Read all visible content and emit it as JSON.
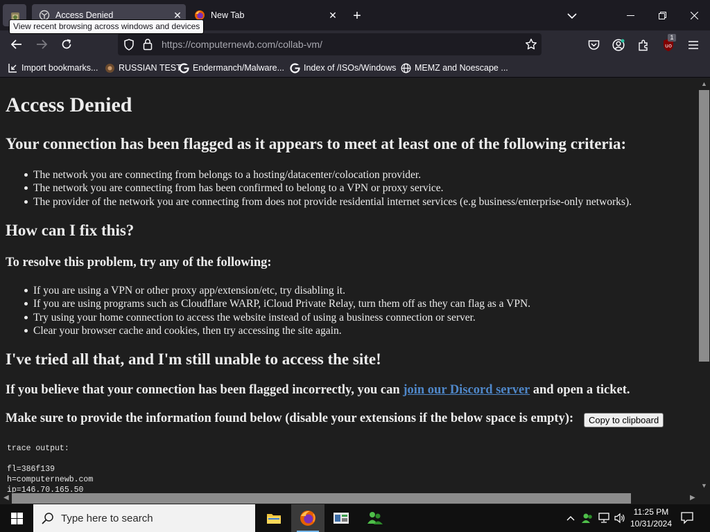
{
  "browser": {
    "tabs": [
      {
        "title": "Access Denied",
        "active": true
      },
      {
        "title": "New Tab",
        "active": false
      }
    ],
    "tooltip": "View recent browsing across windows and devices",
    "url": {
      "host": "https://computernewb.com",
      "path": "/collab-vm/"
    },
    "extension_badge": "1",
    "bookmarks": [
      {
        "label": "Import bookmarks...",
        "icon": "import-icon"
      },
      {
        "label": "RUSSIAN TEST",
        "icon": "russian-test-icon"
      },
      {
        "label": "Endermanch/Malware...",
        "icon": "google-icon"
      },
      {
        "label": "Index of /ISOs/Windows",
        "icon": "google-icon"
      },
      {
        "label": "MEMZ and Noescape ...",
        "icon": "globe-icon"
      }
    ]
  },
  "page": {
    "title": "Access Denied",
    "flag_heading": "Your connection has been flagged as it appears to meet at least one of the following criteria:",
    "criteria": [
      "The network you are connecting from belongs to a hosting/datacenter/colocation provider.",
      "The network you are connecting from has been confirmed to belong to a VPN or proxy service.",
      "The provider of the network you are connecting from does not provide residential internet services (e.g business/enterprise-only networks)."
    ],
    "fix_heading": "How can I fix this?",
    "resolve_heading": "To resolve this problem, try any of the following:",
    "fixes": [
      "If you are using a VPN or other proxy app/extension/etc, try disabling it.",
      "If you are using programs such as Cloudflare WARP, iCloud Private Relay, turn them off as they can flag as a VPN.",
      "Try using your home connection to access the website instead of using a business connection or server.",
      "Clear your browser cache and cookies, then try accessing the site again."
    ],
    "still_heading": "I've tried all that, and I'm still unable to access the site!",
    "ticket_prefix": "If you believe that your connection has been flagged incorrectly, you can ",
    "discord_link": "join our Discord server",
    "ticket_suffix": " and open a ticket.",
    "provide_text": "Make sure to provide the information found below (disable your extensions if the below space is empty):",
    "copy_button": "Copy to clipboard",
    "trace_header": "trace output:",
    "trace_lines": [
      "fl=386f139",
      "h=computernewb.com",
      "ip=146.70.165.50"
    ]
  },
  "taskbar": {
    "search_placeholder": "Type here to search",
    "time": "11:25 PM",
    "date": "10/31/2024",
    "apps": [
      "file-explorer",
      "firefox",
      "network-app",
      "people-app"
    ]
  },
  "colors": {
    "page_bg": "#1e1e1e",
    "link": "#4f87c9",
    "chrome_bg": "#2b2a33",
    "taskbar_bg": "#101010"
  }
}
